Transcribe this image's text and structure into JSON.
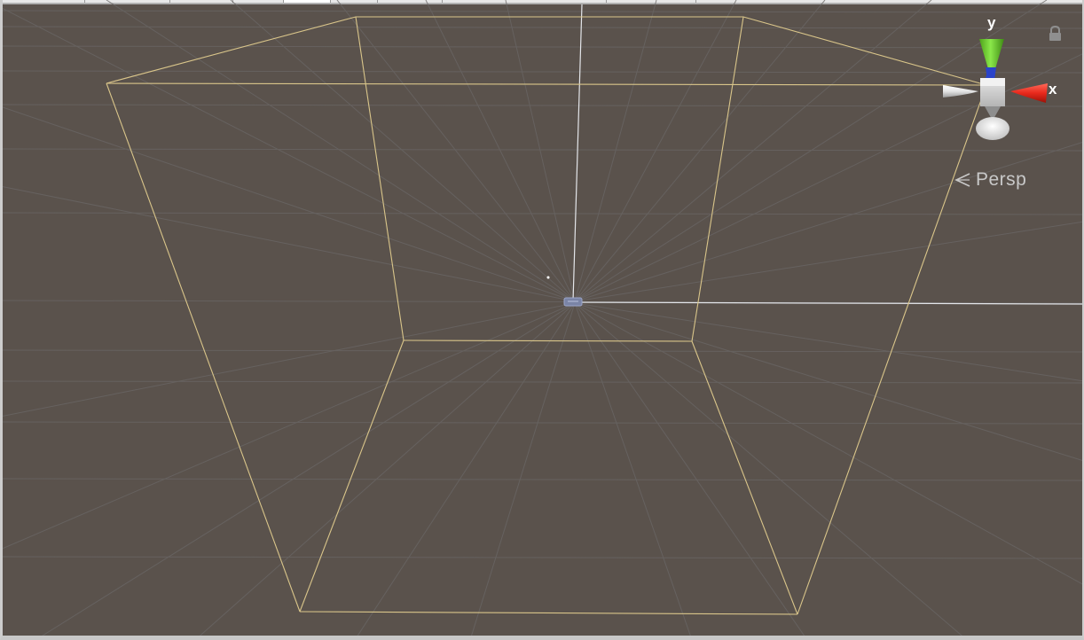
{
  "scene_view": {
    "projection_label": "Persp",
    "gizmo": {
      "y_label": "y",
      "x_label": "x",
      "colors": {
        "y_axis": "#6fd028",
        "x_axis": "#e8291c",
        "z_axis": "#2a43c8",
        "neutral": "#d8d8d8"
      }
    },
    "icons": {
      "lock": "lock-icon",
      "persp_toggle": "chevron-left-icon"
    },
    "colors": {
      "background": "#5a524c",
      "grid": "#6a6766",
      "bounds_wireframe": "#d9c58a",
      "axis_line": "#d9dde2"
    }
  }
}
